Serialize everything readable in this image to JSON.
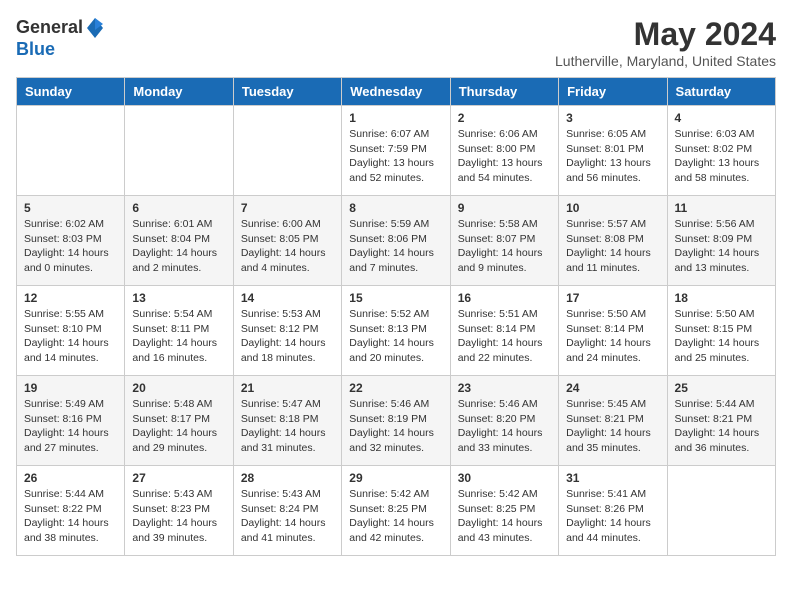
{
  "logo": {
    "general": "General",
    "blue": "Blue"
  },
  "title": "May 2024",
  "location": "Lutherville, Maryland, United States",
  "days_of_week": [
    "Sunday",
    "Monday",
    "Tuesday",
    "Wednesday",
    "Thursday",
    "Friday",
    "Saturday"
  ],
  "weeks": [
    [
      {
        "day": "",
        "info": ""
      },
      {
        "day": "",
        "info": ""
      },
      {
        "day": "",
        "info": ""
      },
      {
        "day": "1",
        "info": "Sunrise: 6:07 AM\nSunset: 7:59 PM\nDaylight: 13 hours\nand 52 minutes."
      },
      {
        "day": "2",
        "info": "Sunrise: 6:06 AM\nSunset: 8:00 PM\nDaylight: 13 hours\nand 54 minutes."
      },
      {
        "day": "3",
        "info": "Sunrise: 6:05 AM\nSunset: 8:01 PM\nDaylight: 13 hours\nand 56 minutes."
      },
      {
        "day": "4",
        "info": "Sunrise: 6:03 AM\nSunset: 8:02 PM\nDaylight: 13 hours\nand 58 minutes."
      }
    ],
    [
      {
        "day": "5",
        "info": "Sunrise: 6:02 AM\nSunset: 8:03 PM\nDaylight: 14 hours\nand 0 minutes."
      },
      {
        "day": "6",
        "info": "Sunrise: 6:01 AM\nSunset: 8:04 PM\nDaylight: 14 hours\nand 2 minutes."
      },
      {
        "day": "7",
        "info": "Sunrise: 6:00 AM\nSunset: 8:05 PM\nDaylight: 14 hours\nand 4 minutes."
      },
      {
        "day": "8",
        "info": "Sunrise: 5:59 AM\nSunset: 8:06 PM\nDaylight: 14 hours\nand 7 minutes."
      },
      {
        "day": "9",
        "info": "Sunrise: 5:58 AM\nSunset: 8:07 PM\nDaylight: 14 hours\nand 9 minutes."
      },
      {
        "day": "10",
        "info": "Sunrise: 5:57 AM\nSunset: 8:08 PM\nDaylight: 14 hours\nand 11 minutes."
      },
      {
        "day": "11",
        "info": "Sunrise: 5:56 AM\nSunset: 8:09 PM\nDaylight: 14 hours\nand 13 minutes."
      }
    ],
    [
      {
        "day": "12",
        "info": "Sunrise: 5:55 AM\nSunset: 8:10 PM\nDaylight: 14 hours\nand 14 minutes."
      },
      {
        "day": "13",
        "info": "Sunrise: 5:54 AM\nSunset: 8:11 PM\nDaylight: 14 hours\nand 16 minutes."
      },
      {
        "day": "14",
        "info": "Sunrise: 5:53 AM\nSunset: 8:12 PM\nDaylight: 14 hours\nand 18 minutes."
      },
      {
        "day": "15",
        "info": "Sunrise: 5:52 AM\nSunset: 8:13 PM\nDaylight: 14 hours\nand 20 minutes."
      },
      {
        "day": "16",
        "info": "Sunrise: 5:51 AM\nSunset: 8:14 PM\nDaylight: 14 hours\nand 22 minutes."
      },
      {
        "day": "17",
        "info": "Sunrise: 5:50 AM\nSunset: 8:14 PM\nDaylight: 14 hours\nand 24 minutes."
      },
      {
        "day": "18",
        "info": "Sunrise: 5:50 AM\nSunset: 8:15 PM\nDaylight: 14 hours\nand 25 minutes."
      }
    ],
    [
      {
        "day": "19",
        "info": "Sunrise: 5:49 AM\nSunset: 8:16 PM\nDaylight: 14 hours\nand 27 minutes."
      },
      {
        "day": "20",
        "info": "Sunrise: 5:48 AM\nSunset: 8:17 PM\nDaylight: 14 hours\nand 29 minutes."
      },
      {
        "day": "21",
        "info": "Sunrise: 5:47 AM\nSunset: 8:18 PM\nDaylight: 14 hours\nand 31 minutes."
      },
      {
        "day": "22",
        "info": "Sunrise: 5:46 AM\nSunset: 8:19 PM\nDaylight: 14 hours\nand 32 minutes."
      },
      {
        "day": "23",
        "info": "Sunrise: 5:46 AM\nSunset: 8:20 PM\nDaylight: 14 hours\nand 33 minutes."
      },
      {
        "day": "24",
        "info": "Sunrise: 5:45 AM\nSunset: 8:21 PM\nDaylight: 14 hours\nand 35 minutes."
      },
      {
        "day": "25",
        "info": "Sunrise: 5:44 AM\nSunset: 8:21 PM\nDaylight: 14 hours\nand 36 minutes."
      }
    ],
    [
      {
        "day": "26",
        "info": "Sunrise: 5:44 AM\nSunset: 8:22 PM\nDaylight: 14 hours\nand 38 minutes."
      },
      {
        "day": "27",
        "info": "Sunrise: 5:43 AM\nSunset: 8:23 PM\nDaylight: 14 hours\nand 39 minutes."
      },
      {
        "day": "28",
        "info": "Sunrise: 5:43 AM\nSunset: 8:24 PM\nDaylight: 14 hours\nand 41 minutes."
      },
      {
        "day": "29",
        "info": "Sunrise: 5:42 AM\nSunset: 8:25 PM\nDaylight: 14 hours\nand 42 minutes."
      },
      {
        "day": "30",
        "info": "Sunrise: 5:42 AM\nSunset: 8:25 PM\nDaylight: 14 hours\nand 43 minutes."
      },
      {
        "day": "31",
        "info": "Sunrise: 5:41 AM\nSunset: 8:26 PM\nDaylight: 14 hours\nand 44 minutes."
      },
      {
        "day": "",
        "info": ""
      }
    ]
  ]
}
